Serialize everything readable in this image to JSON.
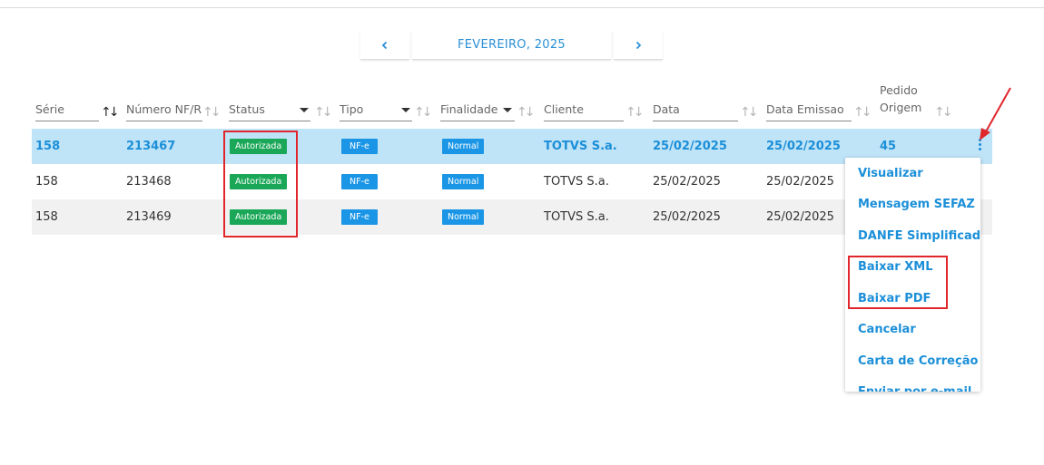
{
  "month_nav": {
    "prev_icon": "chevron-left-icon",
    "label": "FEVEREIRO, 2025",
    "next_icon": "chevron-right-icon"
  },
  "table": {
    "columns": [
      {
        "key": "serie",
        "label": "Série"
      },
      {
        "key": "numero",
        "label": "Número NF/RF"
      },
      {
        "key": "status",
        "label": "Status"
      },
      {
        "key": "tipo",
        "label": "Tipo"
      },
      {
        "key": "finalidade",
        "label": "Finalidade"
      },
      {
        "key": "cliente",
        "label": "Cliente"
      },
      {
        "key": "data",
        "label": "Data"
      },
      {
        "key": "data_emissao",
        "label": "Data Emissao"
      },
      {
        "key": "pedido_origem",
        "label": "Pedido Origem"
      }
    ],
    "rows": [
      {
        "serie": "158",
        "numero": "213467",
        "status": "Autorizada",
        "tipo": "NF-e",
        "finalidade": "Normal",
        "cliente": "TOTVS S.a.",
        "data": "25/02/2025",
        "data_emissao": "25/02/2025",
        "pedido_origem": "45"
      },
      {
        "serie": "158",
        "numero": "213468",
        "status": "Autorizada",
        "tipo": "NF-e",
        "finalidade": "Normal",
        "cliente": "TOTVS S.a.",
        "data": "25/02/2025",
        "data_emissao": "25/02/2025",
        "pedido_origem": ""
      },
      {
        "serie": "158",
        "numero": "213469",
        "status": "Autorizada",
        "tipo": "NF-e",
        "finalidade": "Normal",
        "cliente": "TOTVS S.a.",
        "data": "25/02/2025",
        "data_emissao": "25/02/2025",
        "pedido_origem": ""
      }
    ]
  },
  "row_menu": {
    "items": [
      "Visualizar",
      "Mensagem SEFAZ",
      "DANFE Simplificado",
      "Baixar XML",
      "Baixar PDF",
      "Cancelar",
      "Carta de Correção",
      "Enviar por e-mail"
    ]
  },
  "colors": {
    "accent": "#1b8fd8",
    "selected_row": "#bfe3f7",
    "status_green": "#1aa757",
    "tag_blue": "#1b96e6",
    "annotation_red": "#e0262b"
  }
}
